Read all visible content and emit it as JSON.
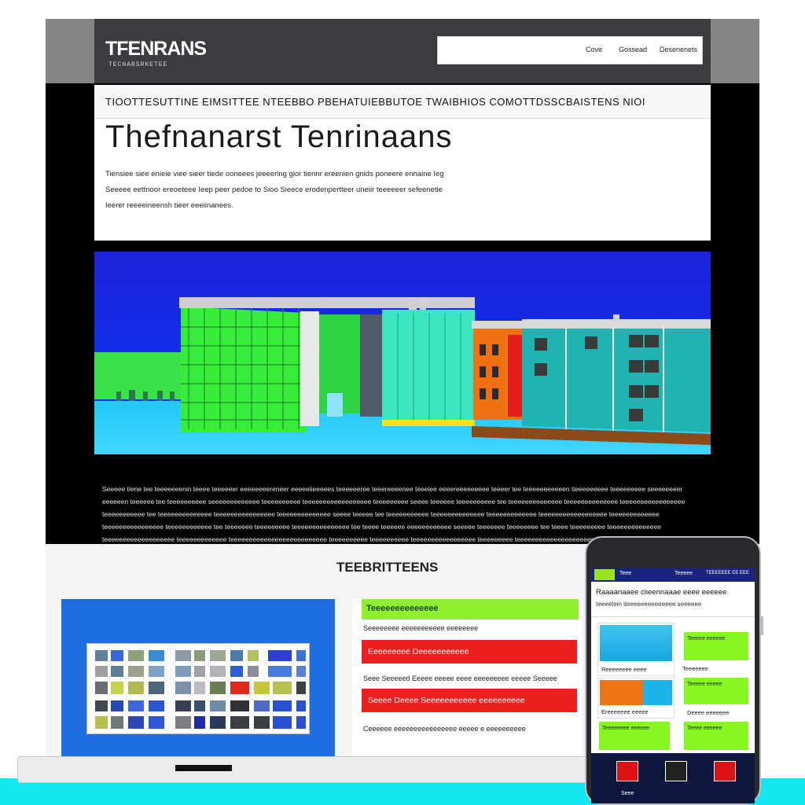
{
  "site": {
    "logo": "TFENRANS",
    "logo_sub": "ТЕСНАRSRКЕТЕЕ",
    "nav": [
      "Cove",
      "Gossead",
      "Desenenets"
    ]
  },
  "hero": {
    "strip": "TIOOTTESUTTINE EIMSITTEE NTEEBBO PBEHATUIEBBUTOE TWAIBHIOS COMOTTDSSCBAISTENS NIOI",
    "title": "Thefnanarst Tenrinaans",
    "desc": "Tiensiee siee enieie viee sieer tiede ooneees jeeeering gior tiennr ereenien gnids poneere ennaine Ieg Seeeee eettnoor ereoeteee Ieep peer pedoe to Sioo Sieece erodenpertteer uneiir teeeeeer sefeenetie Ieerer reeeeineensh tieer eeeiinanees."
  },
  "body_paragraph": "Seeeee tiene tee teeeeeeenin teeee teeeeeer eeeeeeeereneer eeeeeiieeeees teeeeeeree teeereeeenee teeeiee eeeereeeeeeeee teeeer tee teeeeeeeeeeen tieeeeeeeee teeeeeeeee seeeeeeeer eeeeeen teeeeee tee teeeeeeeeee seeeeeeeeeeeee teeeeeeeeee teeeeeeeeeeeeeeeeee teeeeeeeee seeee teeeeee teeeeeeeeee tee teeeeeeeeeeeeee teeeeeeeeeeeeee teeeeeeeeeeeeeeeee teeeeeeeeeee tee teeeeeeeeeeeeee teeeeeeeeeeeeeeee teeeeeeeeeeeeee seeee teeeee tee teeeeeeeeeee teeeeeeeeeeeeee teeeeeeeeeeeee teeeeeeeeeeeeeeeeee teeeeeeeeeeeee teeeeeeeeeeeeeeee teeeeeeeeeeee tee teeeeeee teeeeeeeee teeeeeeeeeeeeeee tee teeee teeeeee eeeeeeeeeeee seeeee teeeeeee teeeeeeee tee teeee teeeeeeeee teeeeeeeeeeeeee teeeeeeeeeeeeeeeeeee teeeeeeeeeeeee teeeeeeeeeeeeeeeeeeeeeeeeee teeeeeeeeee teeeeeeeeee teeeeeeeeeeeeeeeee teeeeeeeee teeeeeeeeeeeeeeeeeeeeeeeeeeeeeeee teeeeeeeeee teeeeeeeeeee teeeeeee teeeeeeeeeee teeeeeeeee teeeeeeeeeeee",
  "lower": {
    "section_title": "TEEBRITTEENS",
    "card": {
      "header": "Teeeeeeeeeeeeee",
      "subtitle": "Seeeeeeee   eeeeeeeeeee   eeeeeeee",
      "red1": "Eeeeeeeee   Deeeeeeeeeee",
      "line1": "Seee   Seeeeed   Eeeee   eeeee   eeee   eeeeeeeee   eeeee   Seeeee",
      "red2": "Seeee   Deeee   Seeeeeeeeeee   eeeeeeeeee",
      "line2": "Ceeeeee   eeeeeeeeeeeeeeee   eeeee   e   eeeeeeeeee"
    }
  },
  "phone": {
    "bar_left": "Teee",
    "bar_mid": "Teeeee",
    "bar_right": "TEEEEEEE  EE  EEE",
    "head_title": "Raaaanaaee ciieennaaae eeee eeeeee",
    "head_sub": "teeeetein iteeeeeeeeeeeeee seeeeee",
    "label_a": "Reeeeeeee eeee",
    "label_b": "Teeeeeee",
    "label_c": "Ereeeeeee eeeee",
    "label_d": "Deeee eeeeeee",
    "green_1": "Teeeee eeeeee",
    "green_2": "Teeeee eeeee",
    "green_3": "Teeeeeeee eeeeee",
    "green_4": "Teeee eeeeee",
    "nav_label": "Seee"
  },
  "colors": {
    "accent_green": "#86f520",
    "alert_red": "#ee1f1f",
    "panel_blue": "#1d6fe0",
    "floor_cyan": "#14e6f2"
  }
}
